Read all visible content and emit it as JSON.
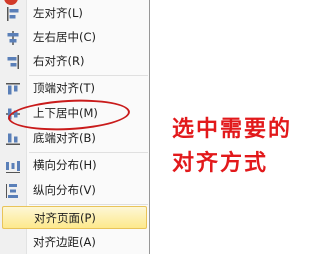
{
  "menu": {
    "items": [
      {
        "label": "左对齐(L)",
        "icon": "align-left-icon"
      },
      {
        "label": "左右居中(C)",
        "icon": "align-center-horizontal-icon"
      },
      {
        "label": "右对齐(R)",
        "icon": "align-right-icon"
      },
      {
        "label": "顶端对齐(T)",
        "icon": "align-top-icon"
      },
      {
        "label": "上下居中(M)",
        "icon": "align-middle-vertical-icon"
      },
      {
        "label": "底端对齐(B)",
        "icon": "align-bottom-icon"
      },
      {
        "label": "横向分布(H)",
        "icon": "distribute-horizontal-icon"
      },
      {
        "label": "纵向分布(V)",
        "icon": "distribute-vertical-icon"
      },
      {
        "label": "对齐页面(P)",
        "icon": "",
        "highlighted": true
      },
      {
        "label": "对齐边距(A)",
        "icon": ""
      }
    ]
  },
  "annotation": {
    "line1": "选中需要的",
    "line2": "对齐方式",
    "color": "#e2191b"
  }
}
